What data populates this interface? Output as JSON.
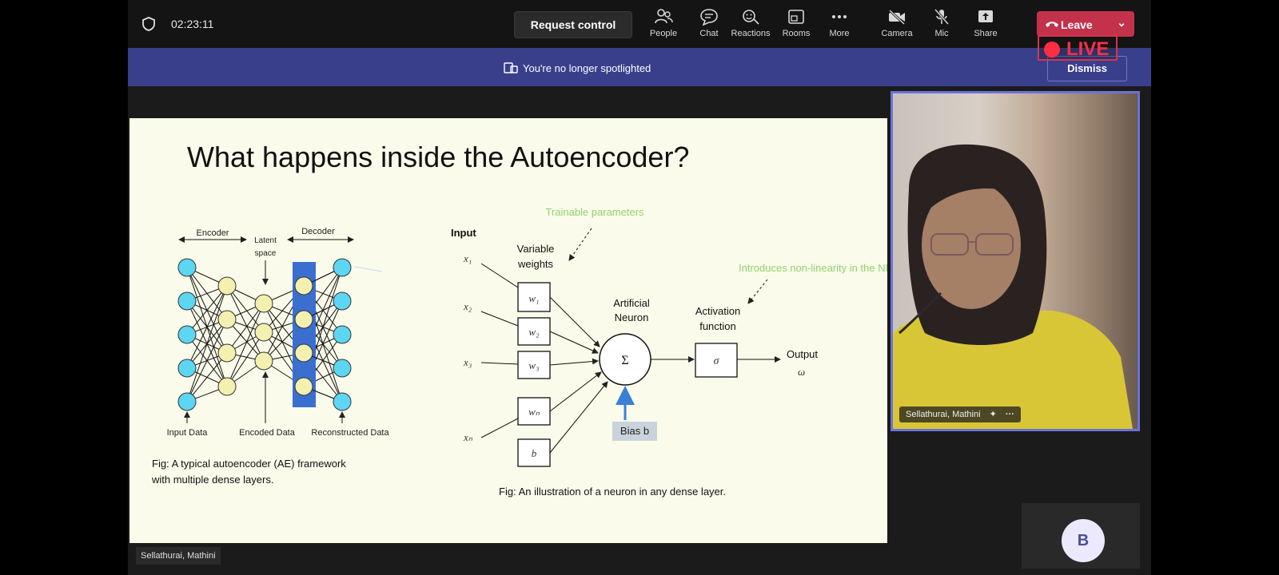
{
  "topbar": {
    "timer": "02:23:11",
    "request_control": "Request control",
    "toolbar": [
      {
        "label": "People",
        "icon": "people-icon"
      },
      {
        "label": "Chat",
        "icon": "chat-icon"
      },
      {
        "label": "Reactions",
        "icon": "reactions-icon"
      },
      {
        "label": "Rooms",
        "icon": "rooms-icon"
      },
      {
        "label": "More",
        "icon": "more-icon"
      },
      {
        "label": "Camera",
        "icon": "camera-off-icon"
      },
      {
        "label": "Mic",
        "icon": "mic-off-icon"
      },
      {
        "label": "Share",
        "icon": "share-icon"
      }
    ],
    "leave_label": "Leave",
    "live_label": "LIVE"
  },
  "banner": {
    "text": "You're no longer spotlighted",
    "dismiss": "Dismiss"
  },
  "slide": {
    "title": "What happens inside the Autoencoder?",
    "ae": {
      "encoder": "Encoder",
      "decoder": "Decoder",
      "latent": [
        "Latent",
        "space"
      ],
      "input_data": "Input Data",
      "encoded_data": "Encoded Data",
      "reconstructed_data": "Reconstructed Data",
      "caption": [
        "Fig: A typical autoencoder (AE) framework",
        "with multiple dense layers."
      ]
    },
    "neuron": {
      "input": "Input",
      "trainable": "Trainable parameters",
      "variable_weights": [
        "Variable",
        "weights"
      ],
      "artificial_neuron": [
        "Artificial",
        "Neuron"
      ],
      "nonlinearity": "Introduces non-linearity in the NN.",
      "activation": [
        "Activation",
        "function"
      ],
      "output": "Output",
      "output_symbol": "ω",
      "sigma": "Σ",
      "activation_symbol": "σ",
      "bias": "Bias b",
      "inputs": [
        "x₁",
        "x₂",
        "x₃",
        "xₙ"
      ],
      "weights": [
        "w₁",
        "w₂",
        "w₃",
        "wₙ",
        "b"
      ],
      "caption": "Fig: An illustration of a neuron in any dense layer."
    }
  },
  "presenter": {
    "name": "Sellathurai, Mathini"
  },
  "participant_tile": {
    "initial": "B"
  },
  "colors": {
    "banner": "#3a3f8c",
    "leave": "#c4314b",
    "live": "#ff2d44",
    "slide_bg": "#fbfbeb",
    "node_cyan": "#5cd6f2",
    "node_yellow": "#f3f0b0",
    "latent_bar": "#3a6fd0",
    "green_annotation": "#8fd36b"
  }
}
